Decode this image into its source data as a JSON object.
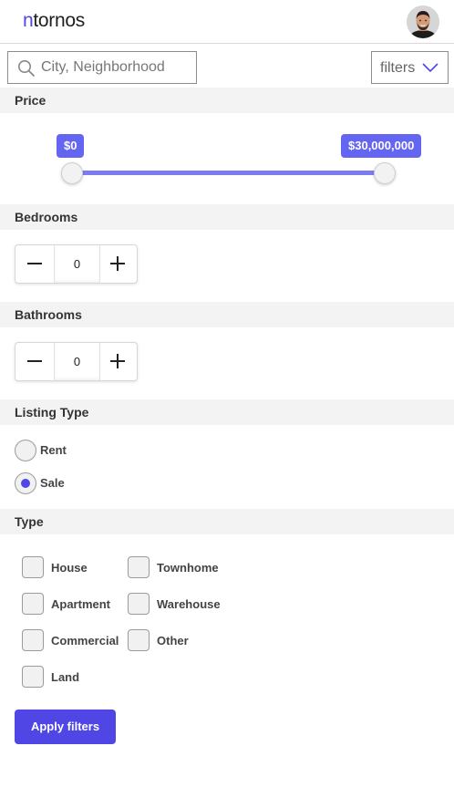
{
  "header": {
    "logo_accent": "n",
    "logo_rest": "tornos"
  },
  "search": {
    "placeholder": "City, Neighborhood",
    "value": ""
  },
  "filters_button": {
    "label": "filters"
  },
  "price": {
    "heading": "Price",
    "min_label": "$0",
    "max_label": "$30,000,000",
    "range_fraction": [
      0,
      1
    ]
  },
  "bedrooms": {
    "heading": "Bedrooms",
    "value": "0"
  },
  "bathrooms": {
    "heading": "Bathrooms",
    "value": "0"
  },
  "listing_type": {
    "heading": "Listing Type",
    "options": [
      {
        "label": "Rent",
        "checked": false
      },
      {
        "label": "Sale",
        "checked": true
      }
    ]
  },
  "type": {
    "heading": "Type",
    "options": [
      {
        "label": "House",
        "checked": false
      },
      {
        "label": "Townhome",
        "checked": false
      },
      {
        "label": "Apartment",
        "checked": false
      },
      {
        "label": "Warehouse",
        "checked": false
      },
      {
        "label": "Commercial",
        "checked": false
      },
      {
        "label": "Other",
        "checked": false
      },
      {
        "label": "Land",
        "checked": false
      }
    ]
  },
  "apply_button": {
    "label": "Apply filters"
  },
  "colors": {
    "accent": "#4f46e5",
    "slider": "#7b7cf2",
    "price_tag": "#6465f1",
    "section_bg": "#f3f3f3"
  }
}
